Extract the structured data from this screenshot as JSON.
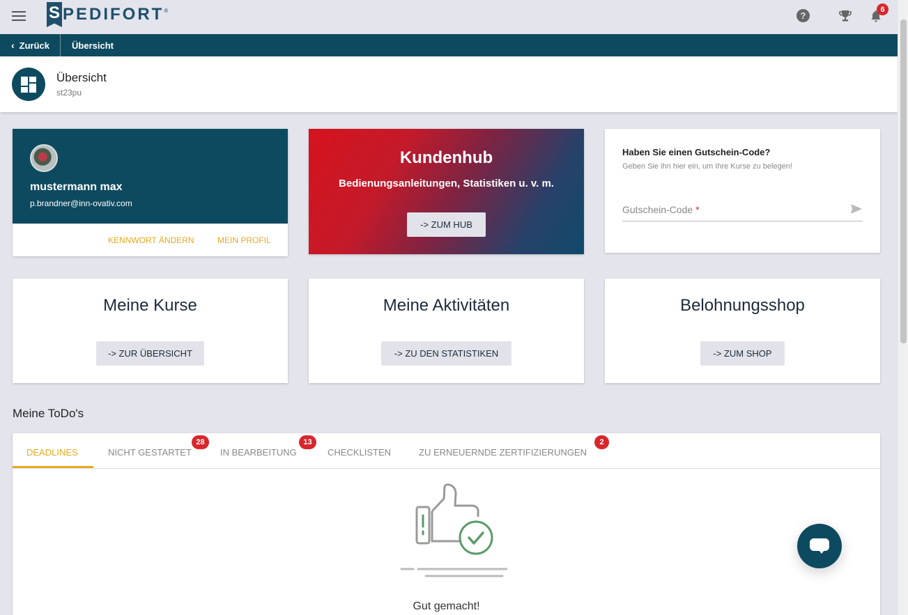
{
  "topbar": {
    "logo_letter": "S",
    "logo_text": "PEDIFORT",
    "logo_reg": "®",
    "help_glyph": "?",
    "notification_count": "6",
    "icons": [
      "menu-icon",
      "help-icon",
      "trophy-icon",
      "bell-icon"
    ]
  },
  "nav": {
    "back_glyph": "‹",
    "back_label": "Zurück",
    "breadcrumb": "Übersicht"
  },
  "header": {
    "title": "Übersicht",
    "subtitle": "st23pu"
  },
  "profile": {
    "name": "mustermann max",
    "email": "p.brandner@inn-ovativ.com",
    "change_password": "Kennwort ändern",
    "my_profile": "Mein Profil"
  },
  "hub": {
    "title": "Kundenhub",
    "subtitle": "Bedienungsanleitungen, Statistiken u. v. m.",
    "button": "-> ZUM HUB"
  },
  "voucher": {
    "title": "Haben Sie einen Gutschein-Code?",
    "subtitle": "Geben Sie ihn hier ein, um Ihre Kurse zu belegen!",
    "label": "Gutschein-Code",
    "required_mark": "*"
  },
  "tiles": [
    {
      "title": "Meine Kurse",
      "button": "-> ZUR ÜBERSICHT"
    },
    {
      "title": "Meine Aktivitäten",
      "button": "-> ZU DEN STATISTIKEN"
    },
    {
      "title": "Belohnungsshop",
      "button": "-> ZUM SHOP"
    }
  ],
  "todos": {
    "section_title": "Meine ToDo's",
    "tabs": [
      {
        "label": "Deadlines",
        "badge": ""
      },
      {
        "label": "Nicht gestartet",
        "badge": "28"
      },
      {
        "label": "In Bearbeitung",
        "badge": "13"
      },
      {
        "label": "Checklisten",
        "badge": ""
      },
      {
        "label": "Zu erneuernde Zertifizierungen",
        "badge": "2"
      }
    ],
    "empty_message": "Gut gemacht!"
  },
  "colors": {
    "primary": "#0e4a5f",
    "accent": "#e8a921",
    "badge": "#d8262c",
    "success": "#5a9a6a"
  }
}
